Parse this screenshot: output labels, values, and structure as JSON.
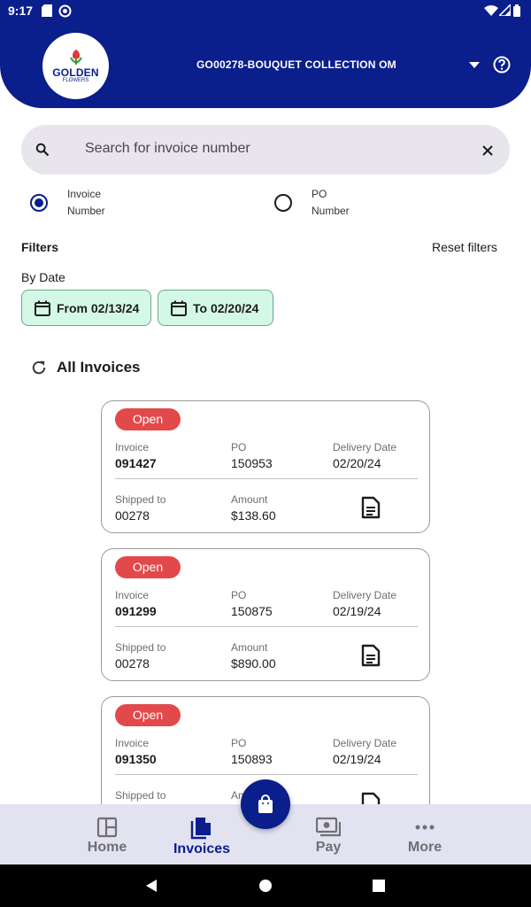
{
  "status_bar": {
    "time": "9:17"
  },
  "header": {
    "logo_text": "GOLDEN",
    "logo_subtext": "FLOWERS",
    "account": "GO00278-BOUQUET COLLECTION OM"
  },
  "search": {
    "placeholder": "Search for invoice number"
  },
  "search_type": {
    "options": [
      {
        "line1": "Invoice",
        "line2": "Number",
        "selected": true
      },
      {
        "line1": "PO",
        "line2": "Number",
        "selected": false
      }
    ]
  },
  "filters": {
    "title": "Filters",
    "reset_label": "Reset filters",
    "by_date_label": "By Date",
    "from_label": "From 02/13/24",
    "to_label": "To 02/20/24"
  },
  "section_title": "All Invoices",
  "labels": {
    "invoice": "Invoice",
    "po": "PO",
    "delivery_date": "Delivery Date",
    "shipped_to": "Shipped to",
    "amount": "Amount"
  },
  "invoices": [
    {
      "status": "Open",
      "invoice": "091427",
      "po": "150953",
      "delivery_date": "02/20/24",
      "shipped_to": "00278",
      "amount": "$138.60"
    },
    {
      "status": "Open",
      "invoice": "091299",
      "po": "150875",
      "delivery_date": "02/19/24",
      "shipped_to": "00278",
      "amount": "$890.00"
    },
    {
      "status": "Open",
      "invoice": "091350",
      "po": "150893",
      "delivery_date": "02/19/24",
      "shipped_to": "",
      "amount": ""
    }
  ],
  "partial_labels": {
    "shipped_to": "Shipped to",
    "amount": "An"
  },
  "bottom_nav": [
    {
      "label": "Home",
      "active": false
    },
    {
      "label": "Invoices",
      "active": true
    },
    {
      "label": "Pay",
      "active": false
    },
    {
      "label": "More",
      "active": false
    }
  ],
  "colors": {
    "brand": "#0a1e8c",
    "open_badge": "#e2494b",
    "chip_bg": "#d4f8e6"
  }
}
